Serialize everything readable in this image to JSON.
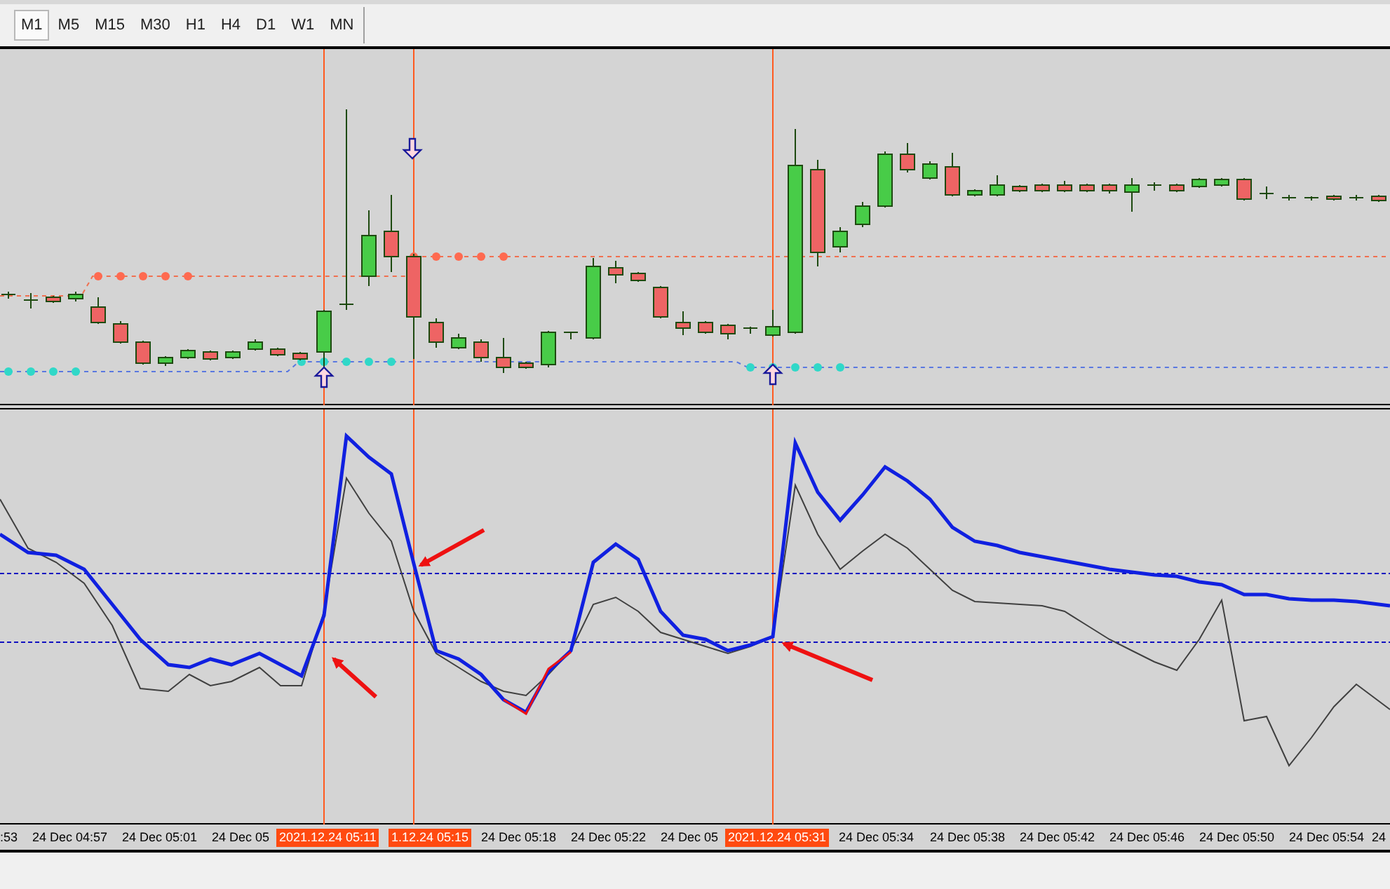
{
  "timeframes": [
    {
      "label": "M1",
      "selected": true
    },
    {
      "label": "M5",
      "selected": false
    },
    {
      "label": "M15",
      "selected": false
    },
    {
      "label": "M30",
      "selected": false
    },
    {
      "label": "H1",
      "selected": false
    },
    {
      "label": "H4",
      "selected": false
    },
    {
      "label": "D1",
      "selected": false
    },
    {
      "label": "W1",
      "selected": false
    },
    {
      "label": "MN",
      "selected": false
    }
  ],
  "time_axis": [
    {
      "label": ":53",
      "kind": "normal"
    },
    {
      "label": "24 Dec 04:57",
      "kind": "normal"
    },
    {
      "label": "24 Dec 05:01",
      "kind": "normal"
    },
    {
      "label": "24 Dec 05",
      "kind": "normal"
    },
    {
      "label": "2021.12.24 05:11",
      "kind": "highlight"
    },
    {
      "label": "1.12.24 05:15",
      "kind": "highlight"
    },
    {
      "label": "24 Dec 05:18",
      "kind": "normal"
    },
    {
      "label": "24 Dec 05:22",
      "kind": "normal"
    },
    {
      "label": "24 Dec 05",
      "kind": "normal"
    },
    {
      "label": "2021.12.24 05:31",
      "kind": "highlight"
    },
    {
      "label": "24 Dec 05:34",
      "kind": "normal"
    },
    {
      "label": "24 Dec 05:38",
      "kind": "normal"
    },
    {
      "label": "24 Dec 05:42",
      "kind": "normal"
    },
    {
      "label": "24 Dec 05:46",
      "kind": "normal"
    },
    {
      "label": "24 Dec 05:50",
      "kind": "normal"
    },
    {
      "label": "24 Dec 05:54",
      "kind": "normal"
    },
    {
      "label": "24",
      "kind": "normal"
    }
  ]
}
